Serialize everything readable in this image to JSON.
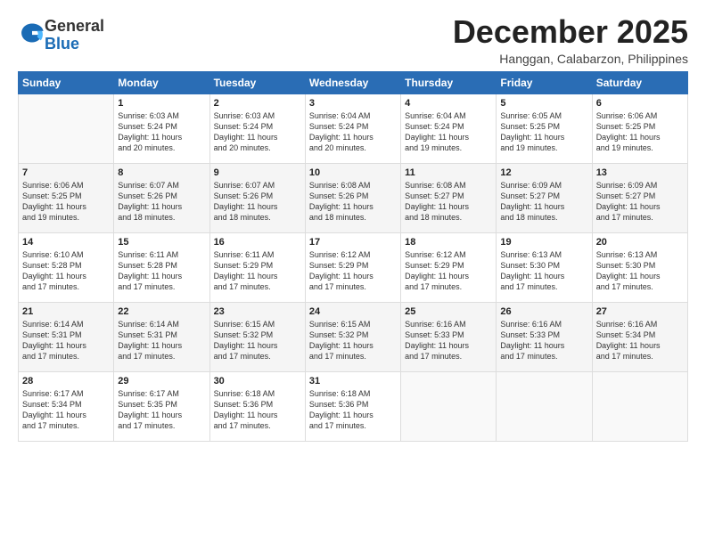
{
  "logo": {
    "general": "General",
    "blue": "Blue"
  },
  "title": "December 2025",
  "location": "Hanggan, Calabarzon, Philippines",
  "days_header": [
    "Sunday",
    "Monday",
    "Tuesday",
    "Wednesday",
    "Thursday",
    "Friday",
    "Saturday"
  ],
  "weeks": [
    [
      {
        "num": "",
        "info": ""
      },
      {
        "num": "1",
        "info": "Sunrise: 6:03 AM\nSunset: 5:24 PM\nDaylight: 11 hours\nand 20 minutes."
      },
      {
        "num": "2",
        "info": "Sunrise: 6:03 AM\nSunset: 5:24 PM\nDaylight: 11 hours\nand 20 minutes."
      },
      {
        "num": "3",
        "info": "Sunrise: 6:04 AM\nSunset: 5:24 PM\nDaylight: 11 hours\nand 20 minutes."
      },
      {
        "num": "4",
        "info": "Sunrise: 6:04 AM\nSunset: 5:24 PM\nDaylight: 11 hours\nand 19 minutes."
      },
      {
        "num": "5",
        "info": "Sunrise: 6:05 AM\nSunset: 5:25 PM\nDaylight: 11 hours\nand 19 minutes."
      },
      {
        "num": "6",
        "info": "Sunrise: 6:06 AM\nSunset: 5:25 PM\nDaylight: 11 hours\nand 19 minutes."
      }
    ],
    [
      {
        "num": "7",
        "info": "Sunrise: 6:06 AM\nSunset: 5:25 PM\nDaylight: 11 hours\nand 19 minutes."
      },
      {
        "num": "8",
        "info": "Sunrise: 6:07 AM\nSunset: 5:26 PM\nDaylight: 11 hours\nand 18 minutes."
      },
      {
        "num": "9",
        "info": "Sunrise: 6:07 AM\nSunset: 5:26 PM\nDaylight: 11 hours\nand 18 minutes."
      },
      {
        "num": "10",
        "info": "Sunrise: 6:08 AM\nSunset: 5:26 PM\nDaylight: 11 hours\nand 18 minutes."
      },
      {
        "num": "11",
        "info": "Sunrise: 6:08 AM\nSunset: 5:27 PM\nDaylight: 11 hours\nand 18 minutes."
      },
      {
        "num": "12",
        "info": "Sunrise: 6:09 AM\nSunset: 5:27 PM\nDaylight: 11 hours\nand 18 minutes."
      },
      {
        "num": "13",
        "info": "Sunrise: 6:09 AM\nSunset: 5:27 PM\nDaylight: 11 hours\nand 17 minutes."
      }
    ],
    [
      {
        "num": "14",
        "info": "Sunrise: 6:10 AM\nSunset: 5:28 PM\nDaylight: 11 hours\nand 17 minutes."
      },
      {
        "num": "15",
        "info": "Sunrise: 6:11 AM\nSunset: 5:28 PM\nDaylight: 11 hours\nand 17 minutes."
      },
      {
        "num": "16",
        "info": "Sunrise: 6:11 AM\nSunset: 5:29 PM\nDaylight: 11 hours\nand 17 minutes."
      },
      {
        "num": "17",
        "info": "Sunrise: 6:12 AM\nSunset: 5:29 PM\nDaylight: 11 hours\nand 17 minutes."
      },
      {
        "num": "18",
        "info": "Sunrise: 6:12 AM\nSunset: 5:29 PM\nDaylight: 11 hours\nand 17 minutes."
      },
      {
        "num": "19",
        "info": "Sunrise: 6:13 AM\nSunset: 5:30 PM\nDaylight: 11 hours\nand 17 minutes."
      },
      {
        "num": "20",
        "info": "Sunrise: 6:13 AM\nSunset: 5:30 PM\nDaylight: 11 hours\nand 17 minutes."
      }
    ],
    [
      {
        "num": "21",
        "info": "Sunrise: 6:14 AM\nSunset: 5:31 PM\nDaylight: 11 hours\nand 17 minutes."
      },
      {
        "num": "22",
        "info": "Sunrise: 6:14 AM\nSunset: 5:31 PM\nDaylight: 11 hours\nand 17 minutes."
      },
      {
        "num": "23",
        "info": "Sunrise: 6:15 AM\nSunset: 5:32 PM\nDaylight: 11 hours\nand 17 minutes."
      },
      {
        "num": "24",
        "info": "Sunrise: 6:15 AM\nSunset: 5:32 PM\nDaylight: 11 hours\nand 17 minutes."
      },
      {
        "num": "25",
        "info": "Sunrise: 6:16 AM\nSunset: 5:33 PM\nDaylight: 11 hours\nand 17 minutes."
      },
      {
        "num": "26",
        "info": "Sunrise: 6:16 AM\nSunset: 5:33 PM\nDaylight: 11 hours\nand 17 minutes."
      },
      {
        "num": "27",
        "info": "Sunrise: 6:16 AM\nSunset: 5:34 PM\nDaylight: 11 hours\nand 17 minutes."
      }
    ],
    [
      {
        "num": "28",
        "info": "Sunrise: 6:17 AM\nSunset: 5:34 PM\nDaylight: 11 hours\nand 17 minutes."
      },
      {
        "num": "29",
        "info": "Sunrise: 6:17 AM\nSunset: 5:35 PM\nDaylight: 11 hours\nand 17 minutes."
      },
      {
        "num": "30",
        "info": "Sunrise: 6:18 AM\nSunset: 5:36 PM\nDaylight: 11 hours\nand 17 minutes."
      },
      {
        "num": "31",
        "info": "Sunrise: 6:18 AM\nSunset: 5:36 PM\nDaylight: 11 hours\nand 17 minutes."
      },
      {
        "num": "",
        "info": ""
      },
      {
        "num": "",
        "info": ""
      },
      {
        "num": "",
        "info": ""
      }
    ]
  ]
}
